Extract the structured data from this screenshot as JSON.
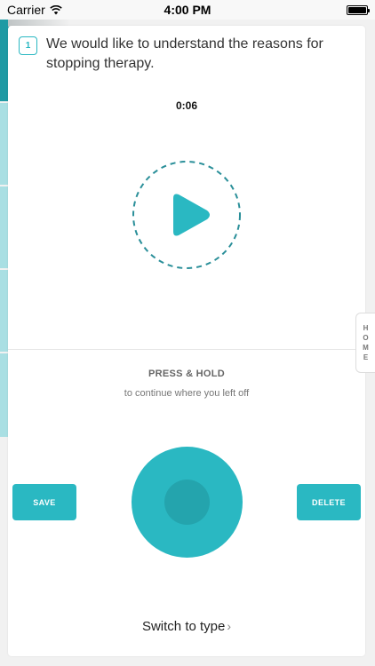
{
  "status_bar": {
    "carrier": "Carrier",
    "time": "4:00 PM",
    "wifi_icon": "wifi-icon",
    "battery_icon": "battery-icon"
  },
  "question": {
    "number": "1",
    "text": "We would like to understand the reasons for stopping therapy."
  },
  "player": {
    "time": "0:06",
    "icon": "play-icon"
  },
  "recorder": {
    "title": "PRESS & HOLD",
    "subtitle": "to continue where you left off",
    "save_label": "SAVE",
    "delete_label": "DELETE",
    "record_icon": "record-button"
  },
  "footer": {
    "switch_label": "Switch to type",
    "chevron": "›"
  },
  "home_tab": {
    "letters": [
      "H",
      "O",
      "M",
      "E"
    ]
  },
  "progress": {
    "total_steps": 5,
    "current_step": 1
  },
  "colors": {
    "accent": "#2ab8c2",
    "accent_dark": "#1f9aa4",
    "strip_light": "#a9dfe3",
    "record_inner": "#24a4ad"
  }
}
